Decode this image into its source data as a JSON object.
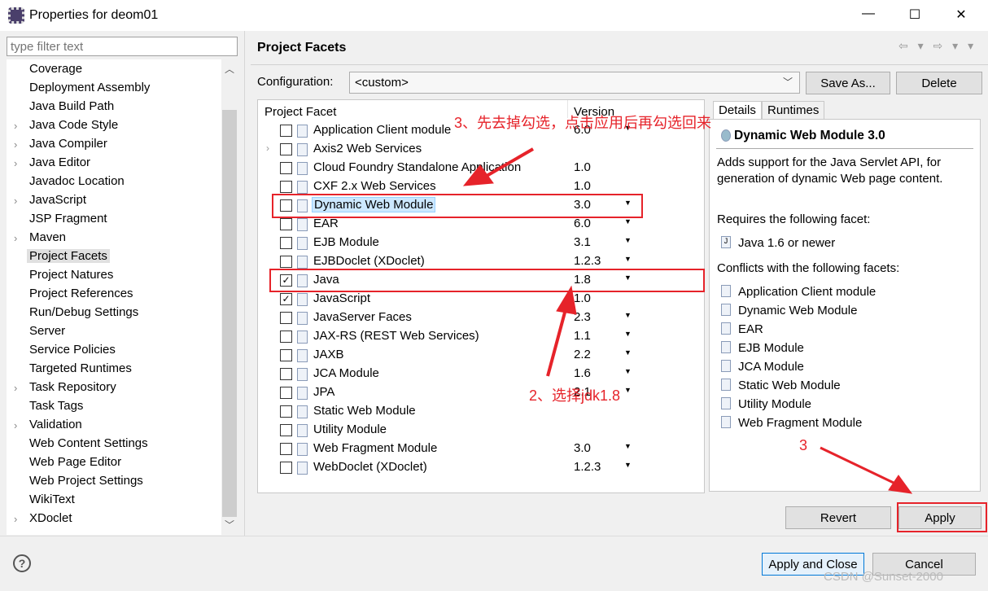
{
  "window": {
    "title": "Properties for deom01",
    "minimize": "—",
    "maximize": "☐",
    "close": "✕"
  },
  "sidebar": {
    "filter_placeholder": "type filter text",
    "selected": "Project Facets",
    "items": [
      {
        "label": "Coverage",
        "expandable": false
      },
      {
        "label": "Deployment Assembly",
        "expandable": false
      },
      {
        "label": "Java Build Path",
        "expandable": false
      },
      {
        "label": "Java Code Style",
        "expandable": true
      },
      {
        "label": "Java Compiler",
        "expandable": true
      },
      {
        "label": "Java Editor",
        "expandable": true
      },
      {
        "label": "Javadoc Location",
        "expandable": false
      },
      {
        "label": "JavaScript",
        "expandable": true
      },
      {
        "label": "JSP Fragment",
        "expandable": false
      },
      {
        "label": "Maven",
        "expandable": true
      },
      {
        "label": "Project Facets",
        "expandable": false
      },
      {
        "label": "Project Natures",
        "expandable": false
      },
      {
        "label": "Project References",
        "expandable": false
      },
      {
        "label": "Run/Debug Settings",
        "expandable": false
      },
      {
        "label": "Server",
        "expandable": false
      },
      {
        "label": "Service Policies",
        "expandable": false
      },
      {
        "label": "Targeted Runtimes",
        "expandable": false
      },
      {
        "label": "Task Repository",
        "expandable": true
      },
      {
        "label": "Task Tags",
        "expandable": false
      },
      {
        "label": "Validation",
        "expandable": true
      },
      {
        "label": "Web Content Settings",
        "expandable": false
      },
      {
        "label": "Web Page Editor",
        "expandable": false
      },
      {
        "label": "Web Project Settings",
        "expandable": false
      },
      {
        "label": "WikiText",
        "expandable": false
      },
      {
        "label": "XDoclet",
        "expandable": true
      }
    ]
  },
  "page": {
    "title": "Project Facets",
    "nav": "⇦ ▾ ⇨ ▾ ▾",
    "config_label": "Configuration:",
    "config_value": "<custom>",
    "save_as": "Save As...",
    "delete": "Delete"
  },
  "facets": {
    "col_facet": "Project Facet",
    "col_version": "Version",
    "rows": [
      {
        "name": "Application Client module",
        "version": "6.0",
        "checked": false,
        "dropdown": true
      },
      {
        "name": "Axis2 Web Services",
        "version": "",
        "checked": false,
        "dropdown": false,
        "expandable": true
      },
      {
        "name": "Cloud Foundry Standalone Application",
        "version": "1.0",
        "checked": false,
        "dropdown": false
      },
      {
        "name": "CXF 2.x Web Services",
        "version": "1.0",
        "checked": false,
        "dropdown": false
      },
      {
        "name": "Dynamic Web Module",
        "version": "3.0",
        "checked": false,
        "dropdown": true,
        "highlighted": true
      },
      {
        "name": "EAR",
        "version": "6.0",
        "checked": false,
        "dropdown": true
      },
      {
        "name": "EJB Module",
        "version": "3.1",
        "checked": false,
        "dropdown": true
      },
      {
        "name": "EJBDoclet (XDoclet)",
        "version": "1.2.3",
        "checked": false,
        "dropdown": true
      },
      {
        "name": "Java",
        "version": "1.8",
        "checked": true,
        "dropdown": true
      },
      {
        "name": "JavaScript",
        "version": "1.0",
        "checked": true,
        "dropdown": false
      },
      {
        "name": "JavaServer Faces",
        "version": "2.3",
        "checked": false,
        "dropdown": true
      },
      {
        "name": "JAX-RS (REST Web Services)",
        "version": "1.1",
        "checked": false,
        "dropdown": true
      },
      {
        "name": "JAXB",
        "version": "2.2",
        "checked": false,
        "dropdown": true
      },
      {
        "name": "JCA Module",
        "version": "1.6",
        "checked": false,
        "dropdown": true
      },
      {
        "name": "JPA",
        "version": "2.1",
        "checked": false,
        "dropdown": true
      },
      {
        "name": "Static Web Module",
        "version": "",
        "checked": false,
        "dropdown": false
      },
      {
        "name": "Utility Module",
        "version": "",
        "checked": false,
        "dropdown": false
      },
      {
        "name": "Web Fragment Module",
        "version": "3.0",
        "checked": false,
        "dropdown": true
      },
      {
        "name": "WebDoclet (XDoclet)",
        "version": "1.2.3",
        "checked": false,
        "dropdown": true
      }
    ]
  },
  "details": {
    "tabs": [
      "Details",
      "Runtimes"
    ],
    "active_tab": "Details",
    "title": "Dynamic Web Module 3.0",
    "description": "Adds support for the Java Servlet API, for generation of dynamic Web page content.",
    "requires_label": "Requires the following facet:",
    "requires": [
      "Java 1.6 or newer"
    ],
    "conflicts_label": "Conflicts with the following facets:",
    "conflicts": [
      "Application Client module",
      "Dynamic Web Module",
      "EAR",
      "EJB Module",
      "JCA Module",
      "Static Web Module",
      "Utility Module",
      "Web Fragment Module"
    ]
  },
  "buttons": {
    "revert": "Revert",
    "apply": "Apply",
    "apply_close": "Apply and Close",
    "cancel": "Cancel",
    "help": "?"
  },
  "annotations": {
    "step3_text": "3、先去掉勾选，点击应用后再勾选回来",
    "step2_text": "2、选择jdk1.8",
    "step3_apply": "3",
    "color": "#e6232a"
  },
  "watermark": "CSDN @Sunset-2000"
}
